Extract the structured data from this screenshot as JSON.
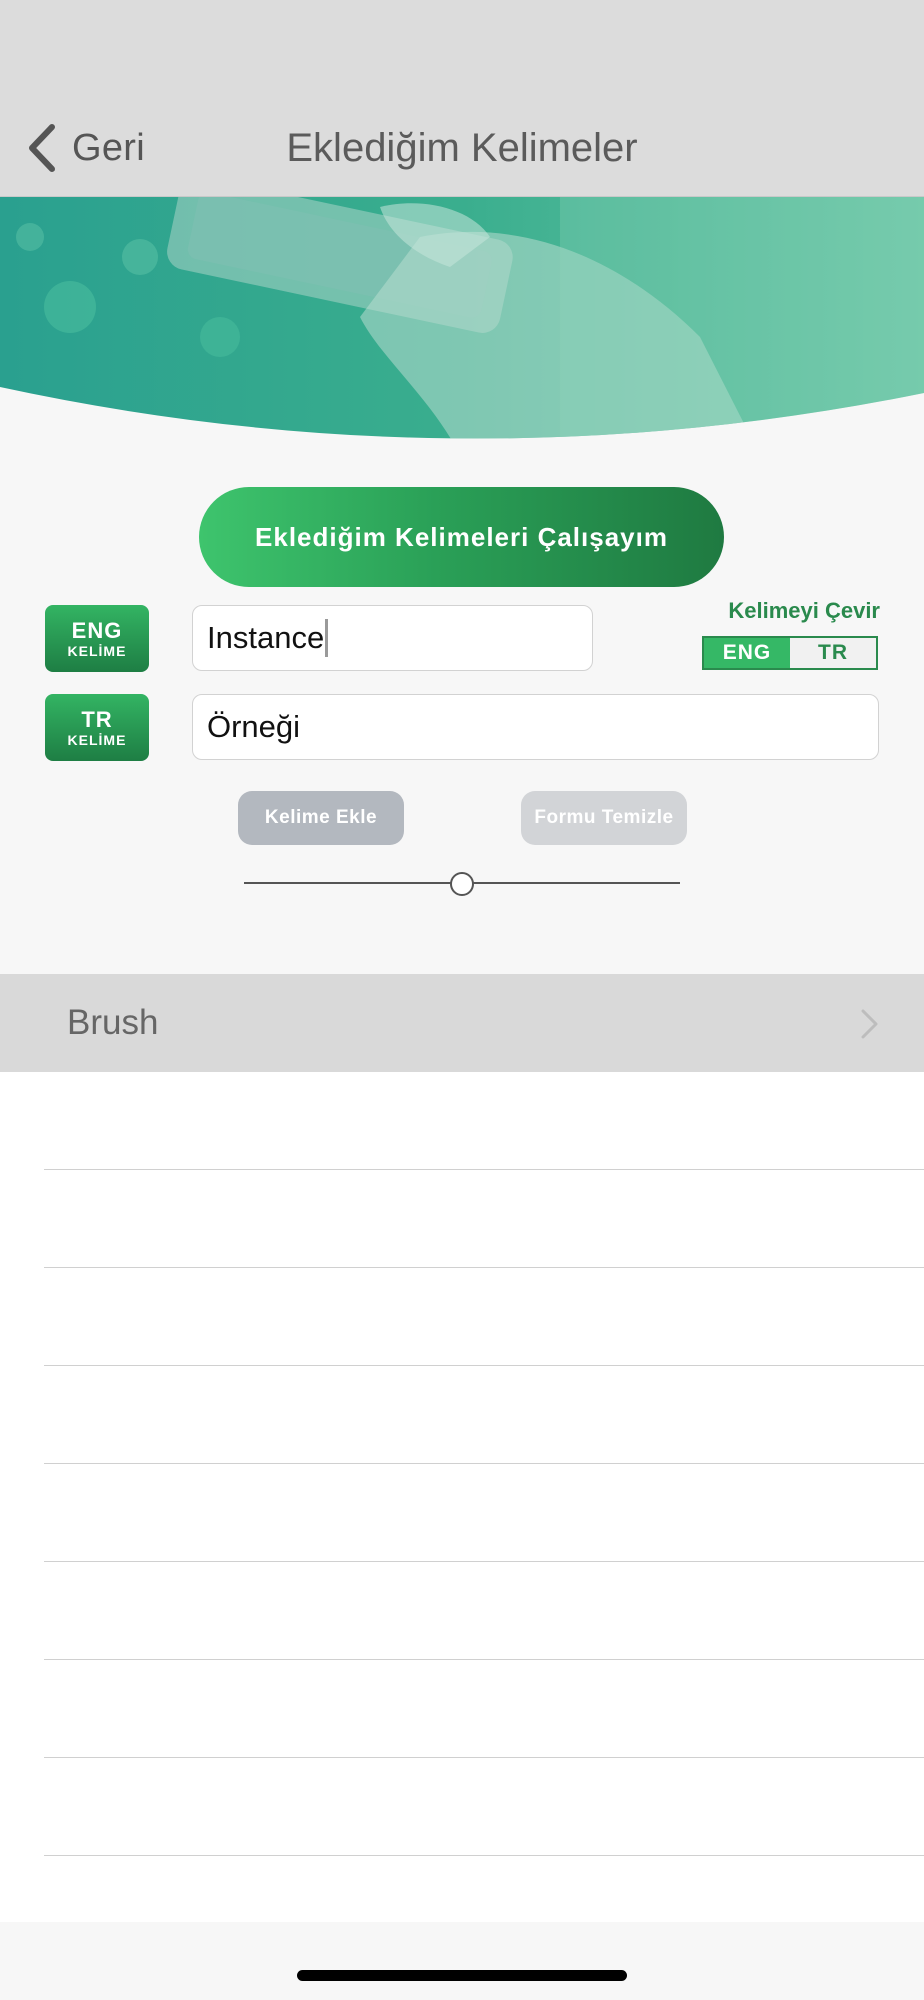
{
  "nav": {
    "back_label": "Geri",
    "title": "Eklediğim Kelimeler"
  },
  "study_button_label": "Eklediğim Kelimeleri Çalışayım",
  "eng_badge": {
    "main": "ENG",
    "sub": "KELİME"
  },
  "tr_badge": {
    "main": "TR",
    "sub": "KELİME"
  },
  "eng_input_value": "Instance",
  "tr_input_value": "Örneği",
  "translate_toggle": {
    "title": "Kelimeyi Çevir",
    "options": [
      "ENG",
      "TR"
    ],
    "selected": "ENG"
  },
  "add_word_button_label": "Kelime Ekle",
  "clear_form_button_label": "Formu Temizle",
  "slider_value": 0.5,
  "word_list": {
    "header_label": "Brush",
    "empty_row_count": 8
  },
  "colors": {
    "accent_green": "#2a8a4d",
    "button_gray": "#b5b9c0"
  }
}
